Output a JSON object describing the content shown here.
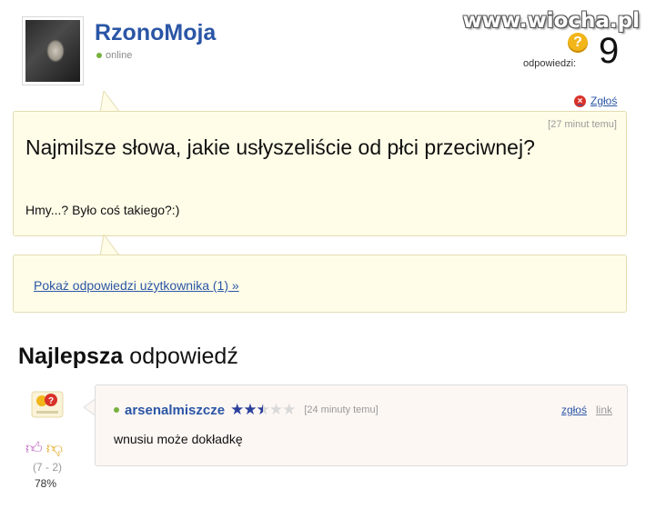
{
  "watermark": "www.wiocha.pl",
  "user": {
    "name": "RzonoMoja",
    "status": "online"
  },
  "answers": {
    "label": "odpowiedzi:",
    "count": "9",
    "badge": "?"
  },
  "report_label": "Zgłoś",
  "question": {
    "time": "[27 minut temu]",
    "title": "Najmilsze słowa, jakie usłyszeliście od płci przeciwnej?",
    "body": "Hmy...? Było coś takiego?:)"
  },
  "show_answers_link": "Pokaż odpowiedzi użytkownika (1) »",
  "best_answer": {
    "heading_bold": "Najlepsza",
    "heading_rest": " odpowiedź",
    "author": "arsenalmiszcze",
    "rating": 2.5,
    "rating_max": 5,
    "time": "[24 minuty temu]",
    "report": "zgłoś",
    "link": "link",
    "text": "wnusiu może dokładkę",
    "votes": "(7 - 2)",
    "percent": "78%"
  },
  "colors": {
    "link_blue": "#2b56a6",
    "box_bg": "#fffde8",
    "online_green": "#79b13e"
  }
}
